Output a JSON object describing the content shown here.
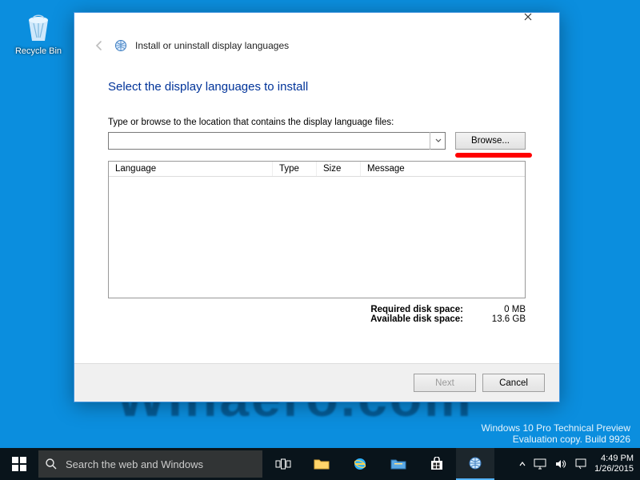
{
  "desktop": {
    "recycle_bin_label": "Recycle Bin",
    "watermark_site": "Winaero.com",
    "watermark_line1": "Windows 10 Pro Technical Preview",
    "watermark_line2": "Evaluation copy. Build 9926"
  },
  "dialog": {
    "title": "Install or uninstall display languages",
    "heading": "Select the display languages to install",
    "prompt": "Type or browse to the location that contains the display language files:",
    "path_value": "",
    "browse_btn": "Browse...",
    "columns": {
      "language": "Language",
      "type": "Type",
      "size": "Size",
      "message": "Message"
    },
    "disk": {
      "required_label": "Required disk space:",
      "required_value": "0 MB",
      "available_label": "Available disk space:",
      "available_value": "13.6 GB"
    },
    "next_btn": "Next",
    "cancel_btn": "Cancel"
  },
  "taskbar": {
    "search_placeholder": "Search the web and Windows",
    "time": "4:49 PM",
    "date": "1/26/2015"
  }
}
